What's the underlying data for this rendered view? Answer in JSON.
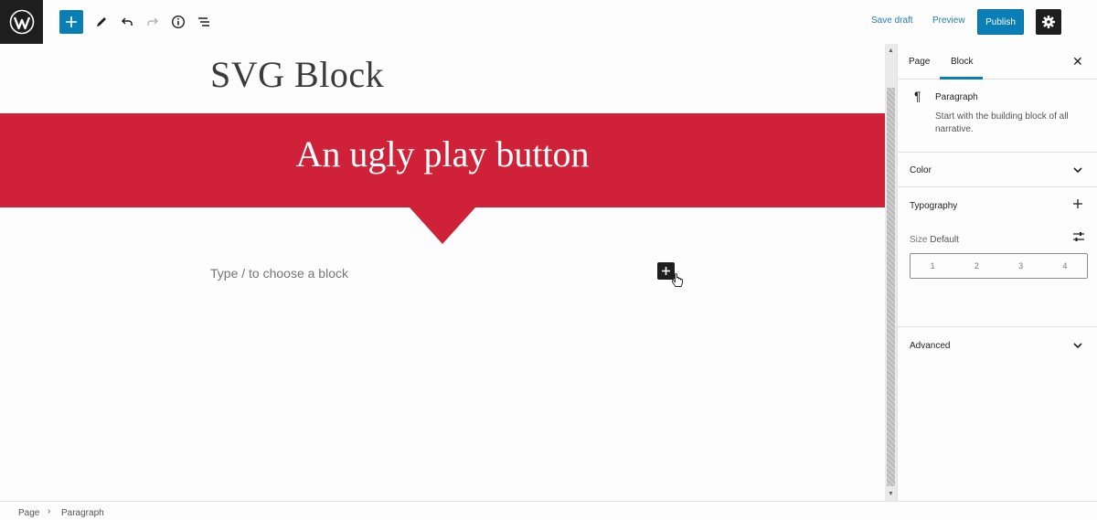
{
  "toolbar": {
    "save_draft": "Save draft",
    "preview": "Preview",
    "publish": "Publish"
  },
  "editor": {
    "title": "SVG Block",
    "banner_text": "An ugly play button",
    "placeholder": "Type / to choose a block"
  },
  "sidebar": {
    "tabs": [
      "Page",
      "Block"
    ],
    "active_tab": "Block",
    "block": {
      "name": "Paragraph",
      "description": "Start with the building block of all narrative."
    },
    "panels": {
      "color": "Color",
      "typography": "Typography",
      "advanced": "Advanced"
    },
    "size": {
      "label": "Size",
      "value": "Default",
      "options": [
        "1",
        "2",
        "3",
        "4"
      ]
    }
  },
  "breadcrumb": [
    "Page",
    "Paragraph"
  ],
  "colors": {
    "accent": "#0a7fb5",
    "banner": "#cf2238",
    "dark": "#1e1e1e"
  }
}
